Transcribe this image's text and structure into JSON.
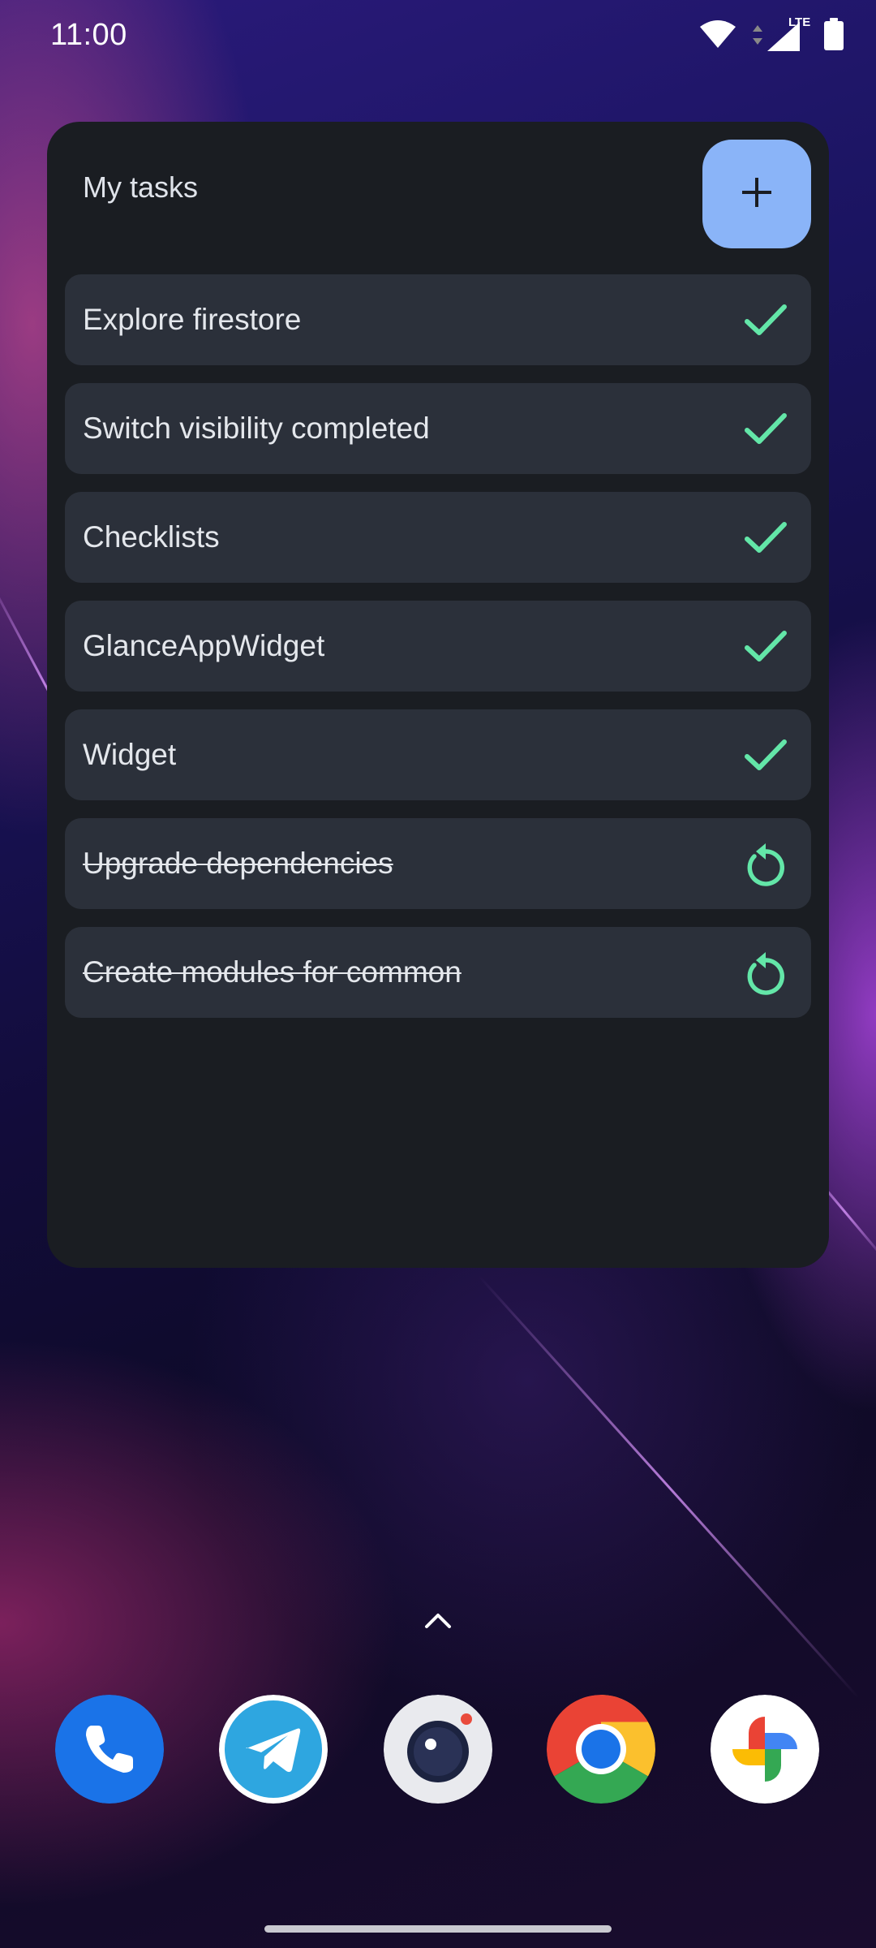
{
  "status_bar": {
    "time": "11:00",
    "network_label": "LTE",
    "icons": [
      "wifi-icon",
      "signal-icon",
      "battery-icon"
    ]
  },
  "widget": {
    "title": "My tasks",
    "add_icon": "plus-icon",
    "accent_color": "#8ab4f8",
    "check_color": "#63e6a8",
    "tasks": [
      {
        "label": "Explore firestore",
        "done": false,
        "action_icon": "check-icon"
      },
      {
        "label": "Switch visibility completed",
        "done": false,
        "action_icon": "check-icon"
      },
      {
        "label": "Checklists",
        "done": false,
        "action_icon": "check-icon"
      },
      {
        "label": "GlanceAppWidget",
        "done": false,
        "action_icon": "check-icon"
      },
      {
        "label": "Widget",
        "done": false,
        "action_icon": "check-icon"
      },
      {
        "label": "Upgrade dependencies",
        "done": true,
        "action_icon": "restore-icon"
      },
      {
        "label": "Create modules for common",
        "done": true,
        "action_icon": "restore-icon"
      }
    ]
  },
  "home": {
    "drawer_icon": "chevron-up-icon",
    "dock_apps": [
      "phone-app-icon",
      "telegram-app-icon",
      "camera-app-icon",
      "chrome-app-icon",
      "photos-app-icon"
    ]
  }
}
